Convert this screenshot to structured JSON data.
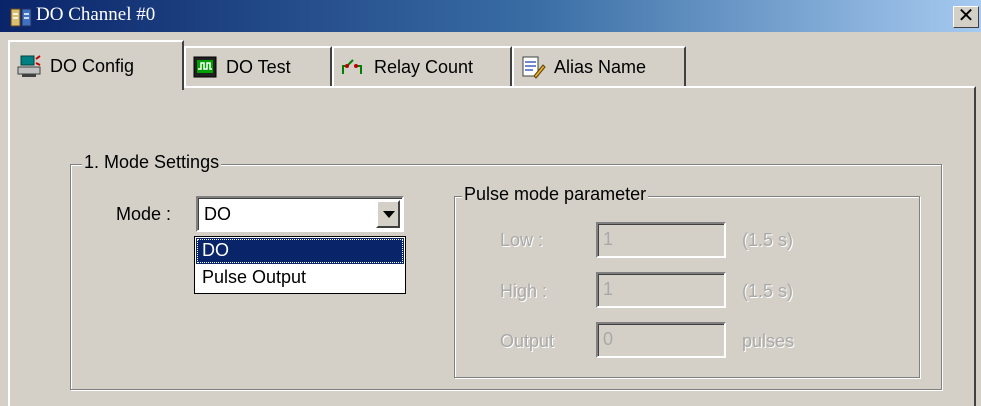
{
  "window": {
    "title": "DO Channel #0",
    "close_glyph": "✕"
  },
  "tabs": [
    {
      "label": "DO Config",
      "icon": "network-config-icon",
      "active": true
    },
    {
      "label": "DO Test",
      "icon": "oscilloscope-icon",
      "active": false
    },
    {
      "label": "Relay Count",
      "icon": "relay-switch-icon",
      "active": false
    },
    {
      "label": "Alias Name",
      "icon": "notepad-pencil-icon",
      "active": false
    }
  ],
  "mode_settings": {
    "legend": "1. Mode Settings",
    "mode_label": "Mode :",
    "selected": "DO",
    "options": [
      "DO",
      "Pulse Output"
    ]
  },
  "pulse_group": {
    "legend": "Pulse mode parameter",
    "low": {
      "label": "Low :",
      "value": "1",
      "unit": "(1.5 s)"
    },
    "high": {
      "label": "High :",
      "value": "1",
      "unit": "(1.5 s)"
    },
    "output": {
      "label": "Output",
      "value": "0",
      "unit": "pulses"
    }
  },
  "colors": {
    "titlebar_start": "#0a246a",
    "titlebar_end": "#a6caf0",
    "face": "#d4d0c8",
    "selection": "#0a246a"
  }
}
